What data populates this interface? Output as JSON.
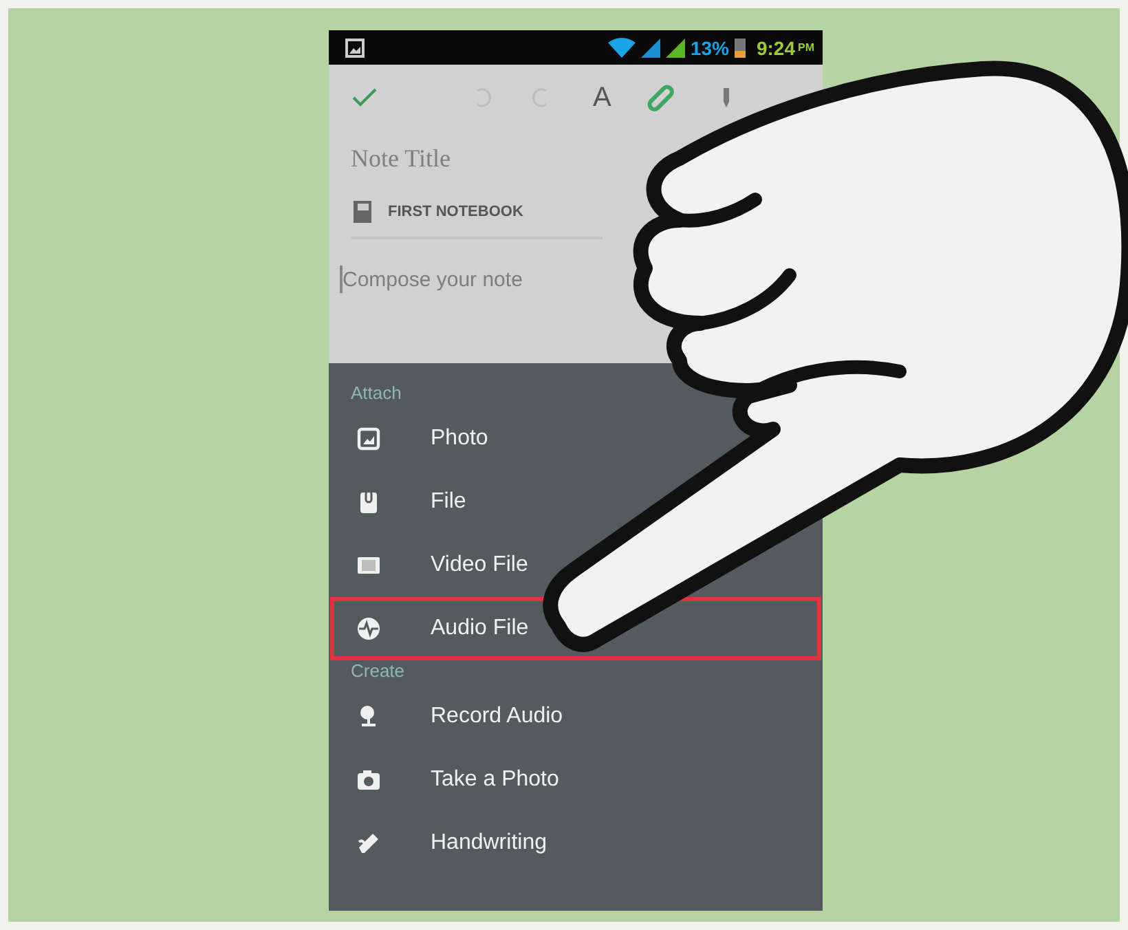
{
  "status_bar": {
    "battery": "13%",
    "time": "9:24",
    "period": "PM"
  },
  "toolbar": {
    "format_label": "A"
  },
  "note": {
    "title_placeholder": "Note Title",
    "notebook": "FIRST NOTEBOOK",
    "body_placeholder": "Compose your note"
  },
  "menu": {
    "sections": [
      {
        "heading": "Attach",
        "items": [
          {
            "label": "Photo",
            "kind": "photo",
            "highlighted": false
          },
          {
            "label": "File",
            "kind": "file",
            "highlighted": false
          },
          {
            "label": "Video File",
            "kind": "video",
            "highlighted": false
          },
          {
            "label": "Audio File",
            "kind": "audio",
            "highlighted": true
          }
        ]
      },
      {
        "heading": "Create",
        "items": [
          {
            "label": "Record Audio",
            "kind": "mic",
            "highlighted": false
          },
          {
            "label": "Take a Photo",
            "kind": "camera",
            "highlighted": false
          },
          {
            "label": "Handwriting",
            "kind": "pen",
            "highlighted": false
          }
        ]
      }
    ]
  }
}
